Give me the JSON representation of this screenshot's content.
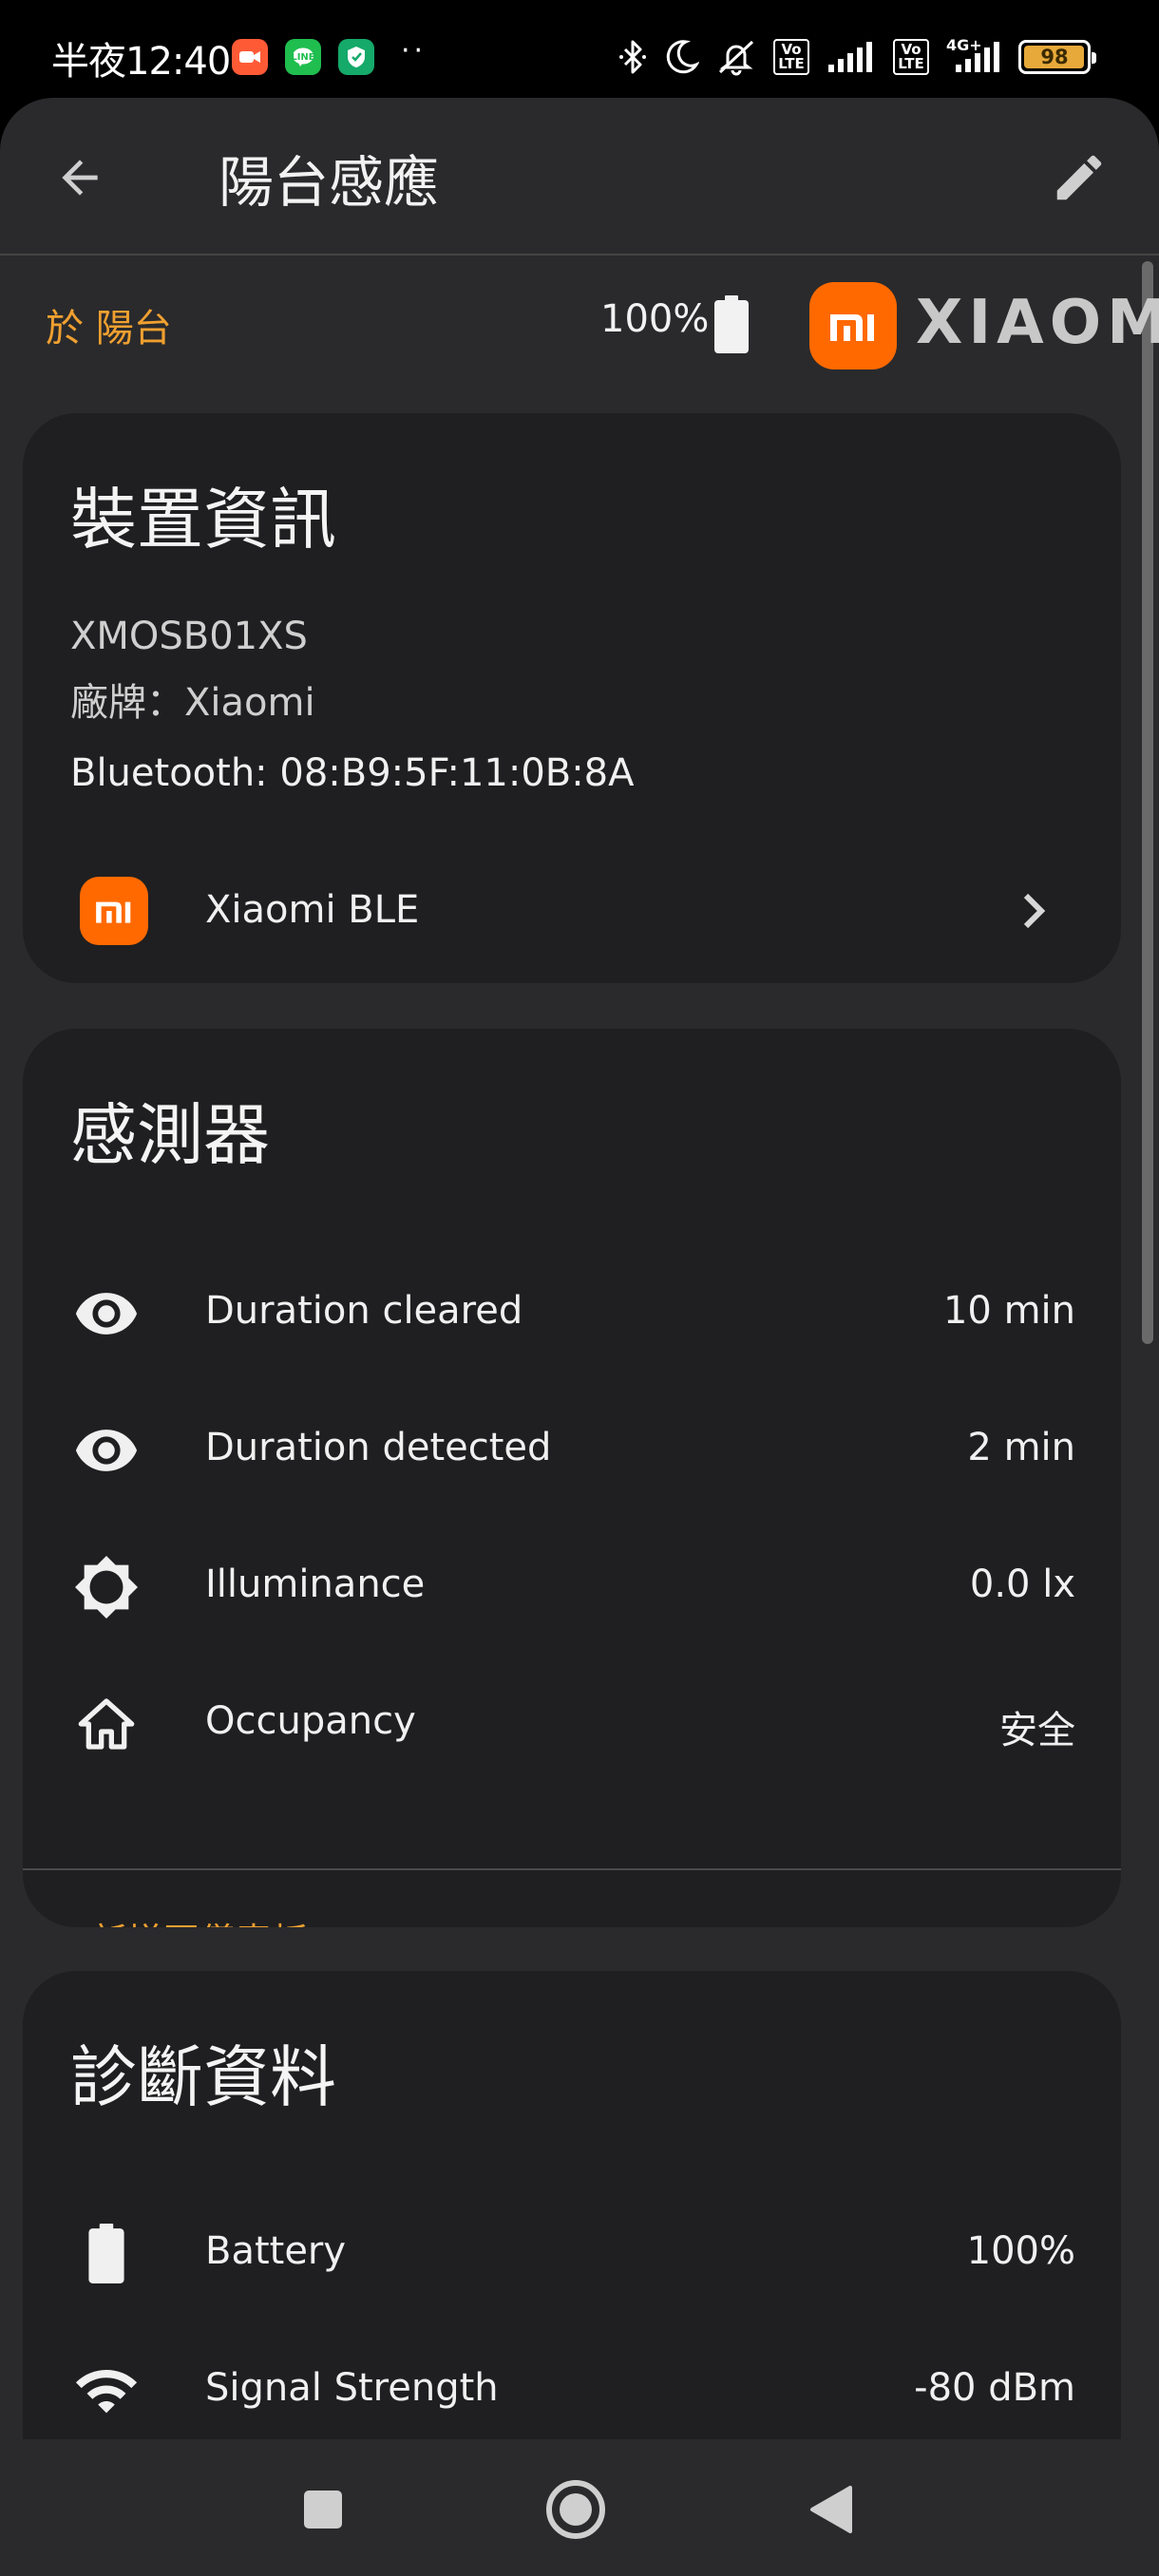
{
  "status_bar": {
    "time": "半夜12:40",
    "more_indicator": "··",
    "volte1": "Vo LTE",
    "volte2": "Vo LTE",
    "network": "4G+",
    "battery": "98",
    "battery_level": 0.98,
    "app_icons": [
      "video-icon",
      "line-icon",
      "shield-icon"
    ],
    "system_icons": [
      "bluetooth-icon",
      "moon-icon",
      "silent-icon",
      "signal-icon",
      "signal-icon"
    ]
  },
  "app_bar": {
    "title": "陽台感應",
    "back_icon": "arrow-left-icon",
    "edit_icon": "pencil-icon"
  },
  "meta": {
    "area": "於 陽台",
    "battery": "100%",
    "brand": "XIAOMI"
  },
  "device_info": {
    "title": "裝置資訊",
    "model": "XMOSB01XS",
    "manufacturer": "廠牌：Xiaomi",
    "connection": "Bluetooth: 08:B9:5F:11:0B:8A",
    "integration": {
      "label": "Xiaomi BLE",
      "icon": "mi-logo-icon"
    }
  },
  "sensors": {
    "title": "感測器",
    "rows": [
      {
        "icon": "eye-icon",
        "name": "Duration cleared",
        "value": "10 min"
      },
      {
        "icon": "eye-icon",
        "name": "Duration detected",
        "value": "2 min"
      },
      {
        "icon": "brightness-icon",
        "name": "Illuminance",
        "value": "0.0 lx"
      },
      {
        "icon": "home-icon",
        "name": "Occupancy",
        "value": "安全"
      }
    ],
    "add_to_dashboard": "新增至儀表板"
  },
  "diagnostics": {
    "title": "診斷資料",
    "rows": [
      {
        "icon": "battery-icon",
        "name": "Battery",
        "value": "100%"
      },
      {
        "icon": "wifi-icon",
        "name": "Signal Strength",
        "value": "-80 dBm"
      }
    ]
  },
  "nav_bar": {
    "buttons": [
      "recents-button",
      "home-button",
      "back-button"
    ]
  },
  "colors": {
    "accent": "#f0a030",
    "brand": "#ff6900",
    "card": "#1f1f21",
    "surface": "#2a2a2c"
  }
}
